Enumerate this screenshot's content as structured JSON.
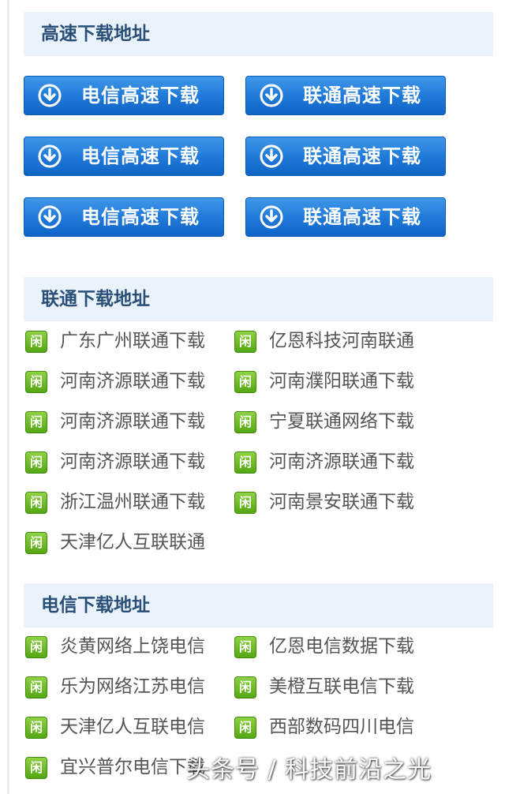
{
  "sections": {
    "high_speed": {
      "title": "高速下载地址",
      "buttons": [
        {
          "label": "电信高速下载"
        },
        {
          "label": "联通高速下载"
        },
        {
          "label": "电信高速下载"
        },
        {
          "label": "联通高速下载"
        },
        {
          "label": "电信高速下载"
        },
        {
          "label": "联通高速下载"
        }
      ]
    },
    "unicom": {
      "title": "联通下载地址",
      "links": [
        {
          "badge": "闲",
          "label": "广东广州联通下载"
        },
        {
          "badge": "闲",
          "label": "亿恩科技河南联通"
        },
        {
          "badge": "闲",
          "label": "河南济源联通下载"
        },
        {
          "badge": "闲",
          "label": "河南濮阳联通下载"
        },
        {
          "badge": "闲",
          "label": "河南济源联通下载"
        },
        {
          "badge": "闲",
          "label": "宁夏联通网络下载"
        },
        {
          "badge": "闲",
          "label": "河南济源联通下载"
        },
        {
          "badge": "闲",
          "label": "河南济源联通下载"
        },
        {
          "badge": "闲",
          "label": "浙江温州联通下载"
        },
        {
          "badge": "闲",
          "label": "河南景安联通下载"
        },
        {
          "badge": "闲",
          "label": "天津亿人互联联通"
        }
      ]
    },
    "telecom": {
      "title": "电信下载地址",
      "links": [
        {
          "badge": "闲",
          "label": "炎黄网络上饶电信"
        },
        {
          "badge": "闲",
          "label": "亿恩电信数据下载"
        },
        {
          "badge": "闲",
          "label": "乐为网络江苏电信"
        },
        {
          "badge": "闲",
          "label": "美橙互联电信下载"
        },
        {
          "badge": "闲",
          "label": "天津亿人互联电信"
        },
        {
          "badge": "闲",
          "label": "西部数码四川电信"
        },
        {
          "badge": "闲",
          "label": "宜兴普尔电信下载"
        }
      ]
    }
  },
  "watermark": "头条号 / 科技前沿之光",
  "colors": {
    "button_blue": "#1f78d8",
    "badge_green": "#54a713",
    "header_bg": "#eaf3fb",
    "header_text": "#2a4f78",
    "link_text": "#555555"
  },
  "icons": {
    "button_icon": "download-circle-icon",
    "badge_icon": "idle-badge-icon"
  }
}
